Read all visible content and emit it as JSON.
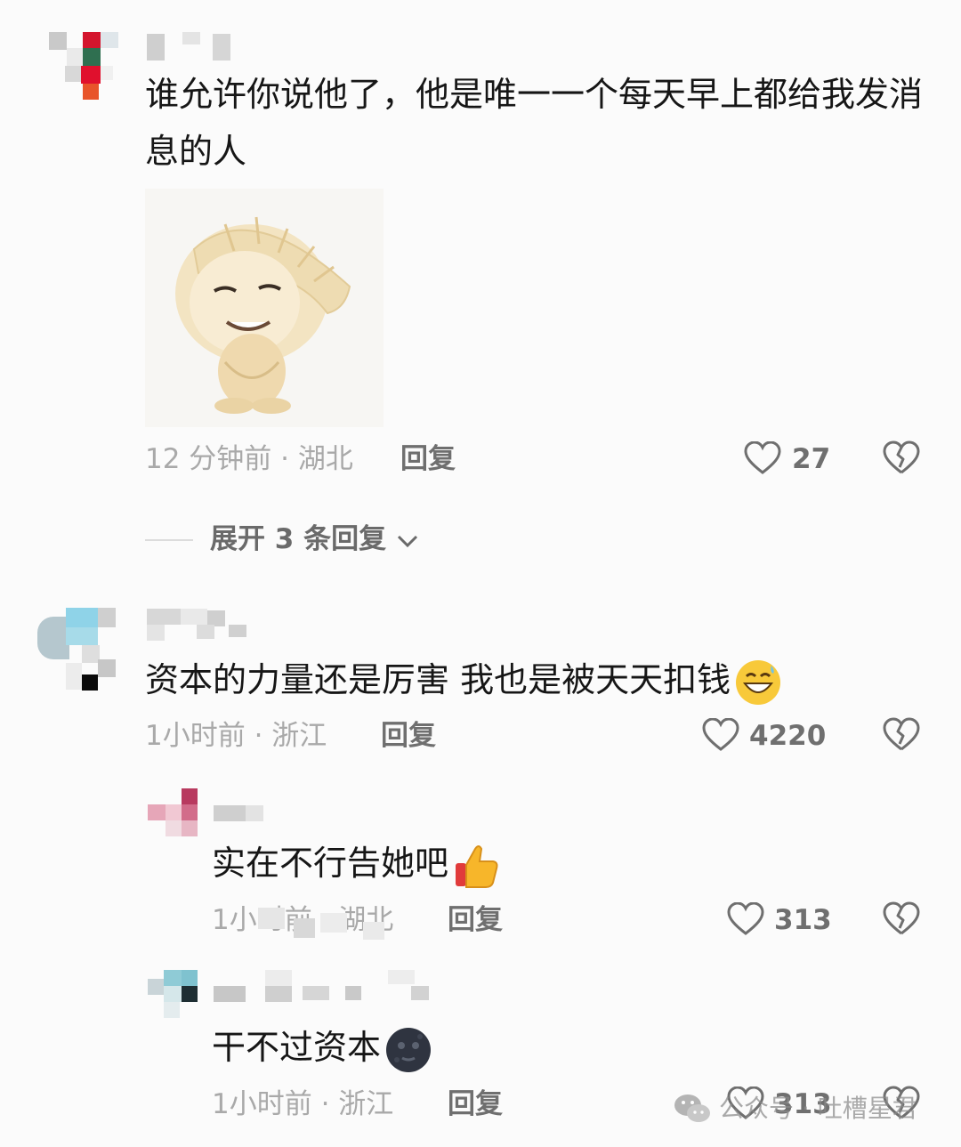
{
  "comments": [
    {
      "text": "谁允许你说他了，他是唯一一个每天早上都给我发消息的人",
      "time_location": "12 分钟前 · 湖北",
      "reply_label": "回复",
      "likes": "27",
      "image": "dumpling-meme-sticker"
    },
    {
      "text": "资本的力量还是厉害 我也是被天天扣钱",
      "emoji": "grinning-sweat-face",
      "time_location": "1小时前 · 浙江",
      "reply_label": "回复",
      "likes": "4220"
    }
  ],
  "expand": {
    "label": "展开 3 条回复"
  },
  "replies": [
    {
      "text": "实在不行告她吧",
      "emoji": "thumbs-up",
      "time_location": "1小时前 · 湖北",
      "reply_label": "回复",
      "likes": "313"
    },
    {
      "text": "干不过资本",
      "emoji": "new-moon-face",
      "time_location": "1小时前 · 浙江",
      "reply_label": "回复",
      "likes": "313"
    }
  ],
  "watermark": {
    "text": "公众号 · 吐槽星君",
    "icon": "wechat-icon"
  },
  "colors": {
    "text": "#161616",
    "meta": "#a9a9a9",
    "action": "#6f6f6f",
    "background": "#fbfbfb"
  }
}
